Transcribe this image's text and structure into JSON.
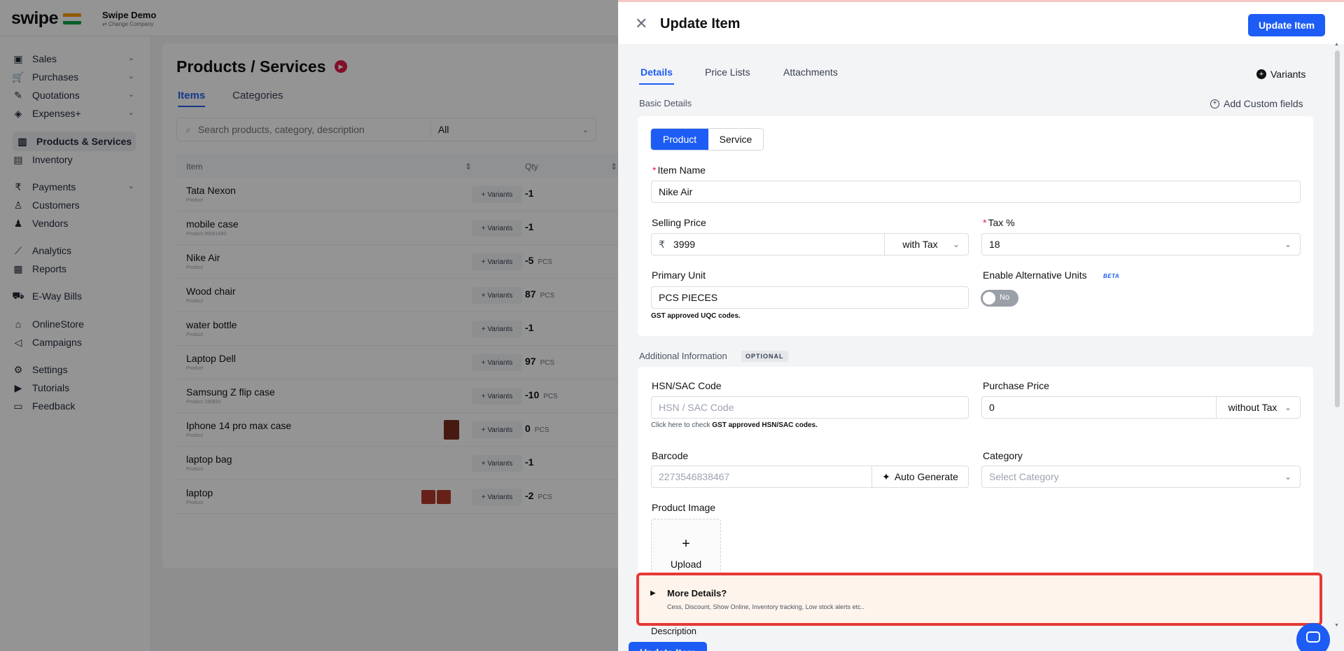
{
  "app": {
    "logo": "swipe",
    "company_name": "Swipe Demo",
    "company_sub": "⇄ Change Company"
  },
  "sidebar": {
    "items": [
      {
        "label": "Sales",
        "icon": "sales-icon",
        "chevron": true
      },
      {
        "label": "Purchases",
        "icon": "cart-icon",
        "chevron": true
      },
      {
        "label": "Quotations",
        "icon": "pen-icon",
        "chevron": true
      },
      {
        "label": "Expenses+",
        "icon": "tag-icon",
        "chevron": true
      },
      {
        "label": "Products & Services",
        "icon": "barcode-icon",
        "chevron": false,
        "active": true
      },
      {
        "label": "Inventory",
        "icon": "inventory-icon",
        "chevron": false
      },
      {
        "label": "Payments",
        "icon": "rupee-icon",
        "chevron": true
      },
      {
        "label": "Customers",
        "icon": "user-icon",
        "chevron": false
      },
      {
        "label": "Vendors",
        "icon": "users-icon",
        "chevron": false
      },
      {
        "label": "Analytics",
        "icon": "chart-icon",
        "chevron": false
      },
      {
        "label": "Reports",
        "icon": "report-icon",
        "chevron": false
      },
      {
        "label": "E-Way Bills",
        "icon": "truck-icon",
        "chevron": false
      },
      {
        "label": "OnlineStore",
        "icon": "store-icon",
        "chevron": false
      },
      {
        "label": "Campaigns",
        "icon": "megaphone-icon",
        "chevron": false
      },
      {
        "label": "Settings",
        "icon": "gear-icon",
        "chevron": false
      },
      {
        "label": "Tutorials",
        "icon": "youtube-icon",
        "chevron": false
      },
      {
        "label": "Feedback",
        "icon": "message-icon",
        "chevron": false
      }
    ],
    "chevron_glyph": "⌄"
  },
  "main": {
    "title": "Products / Services",
    "tabs": [
      "Items",
      "Categories"
    ],
    "search_placeholder": "Search products, category, description",
    "filter_value": "All",
    "columns": [
      "Item",
      "Qty"
    ],
    "variants_label": "+ Variants",
    "rows": [
      {
        "name": "Tata Nexon",
        "sub": "Product",
        "qty": "-1",
        "unit": ""
      },
      {
        "name": "mobile case",
        "sub": "Product 86081680",
        "qty": "-1",
        "unit": ""
      },
      {
        "name": "Nike Air",
        "sub": "Product",
        "qty": "-5",
        "unit": "PCS"
      },
      {
        "name": "Wood chair",
        "sub": "Product",
        "qty": "87",
        "unit": "PCS"
      },
      {
        "name": "water bottle",
        "sub": "Product",
        "qty": "-1",
        "unit": ""
      },
      {
        "name": "Laptop Dell",
        "sub": "Product",
        "qty": "97",
        "unit": "PCS"
      },
      {
        "name": "Samsung Z flip case",
        "sub": "Product 190820",
        "qty": "-10",
        "unit": "PCS"
      },
      {
        "name": "Iphone 14 pro max case",
        "sub": "Product",
        "qty": "0",
        "unit": "PCS"
      },
      {
        "name": "laptop bag",
        "sub": "Product",
        "qty": "-1",
        "unit": ""
      },
      {
        "name": "laptop",
        "sub": "Product",
        "qty": "-2",
        "unit": "PCS"
      }
    ]
  },
  "drawer": {
    "title": "Update Item",
    "update_button": "Update Item",
    "tabs": [
      "Details",
      "Price Lists",
      "Attachments"
    ],
    "variants": "Variants",
    "basic_details": "Basic Details",
    "add_custom_fields": "Add Custom fields",
    "type_options": [
      "Product",
      "Service"
    ],
    "item_name_label": "Item Name",
    "item_name_value": "Nike Air",
    "selling_price_label": "Selling Price",
    "currency": "₹",
    "selling_price_value": "3999",
    "selling_tax_mode": "with Tax",
    "tax_label": "Tax %",
    "tax_value": "18",
    "primary_unit_label": "Primary Unit",
    "primary_unit_value": "PCS PIECES",
    "uqc_hint": "GST approved UQC codes.",
    "alt_units_label": "Enable Alternative Units",
    "beta": "BETA",
    "alt_units_toggle": "No",
    "additional_info": "Additional Information",
    "optional": "OPTIONAL",
    "hsn_label": "HSN/SAC Code",
    "hsn_placeholder": "HSN / SAC Code",
    "hsn_hint_pre": "Click here to check ",
    "hsn_hint_bold": "GST approved HSN/SAC codes.",
    "purchase_price_label": "Purchase Price",
    "purchase_price_value": "0",
    "purchase_tax_mode": "without Tax",
    "barcode_label": "Barcode",
    "barcode_placeholder": "2273546838467",
    "auto_generate": "Auto Generate",
    "category_label": "Category",
    "category_placeholder": "Select Category",
    "product_image_label": "Product Image",
    "upload_plus": "+",
    "upload_label": "Upload",
    "more_details_title": "More Details?",
    "more_details_sub": "Cess, Discount, Show Online, Inventory tracking, Low stock alerts etc..",
    "description_label": "Description"
  },
  "colors": {
    "primary": "#1d5cf5",
    "highlight": "#e53935",
    "required": "#e11d48"
  }
}
